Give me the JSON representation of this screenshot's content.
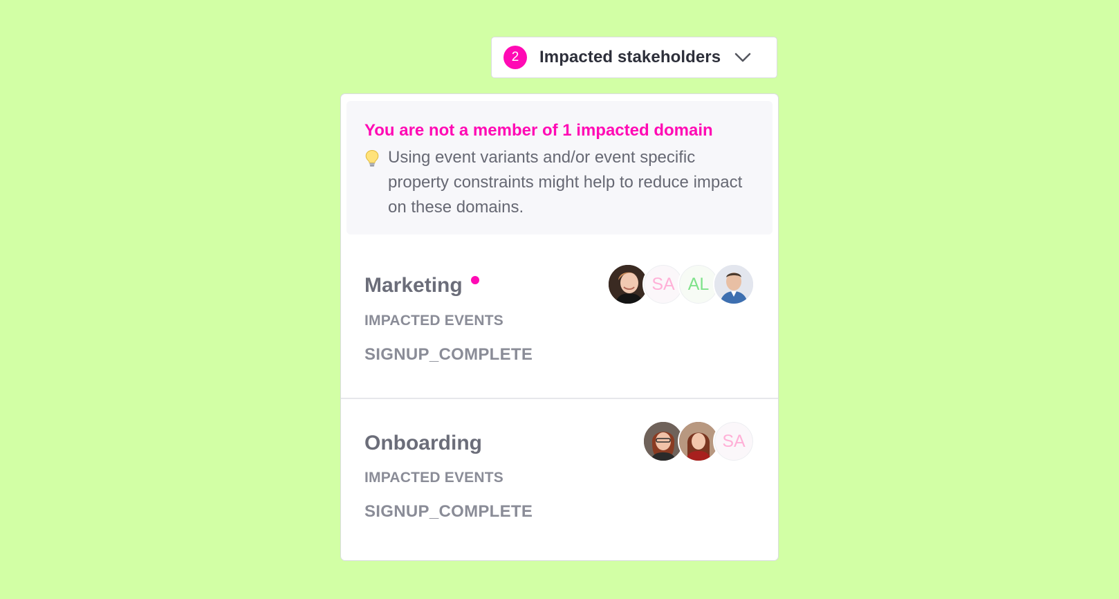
{
  "trigger": {
    "count": "2",
    "label": "Impacted stakeholders",
    "icon": "chevron-down-icon"
  },
  "notice": {
    "title": "You are not a member of 1 impacted domain",
    "icon": "lightbulb-icon",
    "body": "Using event variants and/or event specific property constraints might help to reduce impact on these domains."
  },
  "domains": [
    {
      "name": "Marketing",
      "is_not_member": true,
      "events_label": "IMPACTED EVENTS",
      "events": [
        "SIGNUP_COMPLETE"
      ],
      "stakeholders": [
        {
          "type": "photo"
        },
        {
          "type": "initials",
          "initials": "SA",
          "color": "#ffb0d7"
        },
        {
          "type": "initials",
          "initials": "AL",
          "color": "#7fe28a"
        },
        {
          "type": "photo"
        }
      ]
    },
    {
      "name": "Onboarding",
      "is_not_member": false,
      "events_label": "IMPACTED EVENTS",
      "events": [
        "SIGNUP_COMPLETE"
      ],
      "stakeholders": [
        {
          "type": "photo"
        },
        {
          "type": "photo"
        },
        {
          "type": "initials",
          "initials": "SA",
          "color": "#ffb0d7"
        }
      ]
    }
  ],
  "colors": {
    "background": "#d2ffa5",
    "accent": "#ff0ab4"
  }
}
